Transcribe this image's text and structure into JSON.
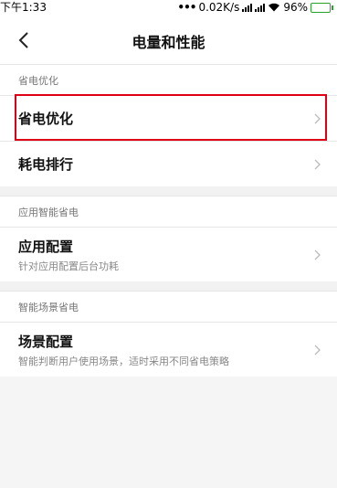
{
  "status": {
    "time": "下午1:33",
    "net_speed": "0.02K/s",
    "battery_pct": "96%",
    "battery_level": 0.96,
    "dots": "•••"
  },
  "header": {
    "title": "电量和性能"
  },
  "sections": [
    {
      "header": "省电优化",
      "rows": [
        {
          "title": "省电优化",
          "subtitle": ""
        },
        {
          "title": "耗电排行",
          "subtitle": ""
        }
      ]
    },
    {
      "header": "应用智能省电",
      "rows": [
        {
          "title": "应用配置",
          "subtitle": "针对应用配置后台功耗"
        }
      ]
    },
    {
      "header": "智能场景省电",
      "rows": [
        {
          "title": "场景配置",
          "subtitle": "智能判断用户使用场景，适时采用不同省电策略"
        }
      ]
    }
  ],
  "colors": {
    "highlight": "#e00016",
    "battery": "#3fc13f"
  },
  "icons": [
    "back-arrow-icon",
    "chevron-right-icon",
    "signal-icon",
    "wifi-icon",
    "battery-icon"
  ]
}
